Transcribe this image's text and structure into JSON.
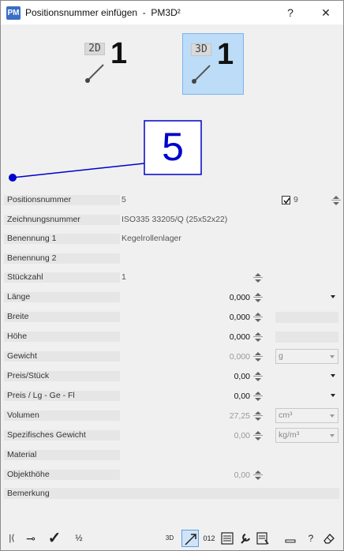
{
  "window": {
    "title": "Positionsnummer einfügen  -  PM3D²",
    "help_label": "?",
    "close_label": "✕",
    "app_icon_text": "PM"
  },
  "modes": {
    "mode_2d": {
      "tag": "2D",
      "number": "1",
      "active": false
    },
    "mode_3d": {
      "tag": "3D",
      "number": "1",
      "active": true
    }
  },
  "preview": {
    "balloon_number": "5",
    "line_color": "#0000cc"
  },
  "form": {
    "positionsnummer": {
      "label": "Positionsnummer",
      "value": "5",
      "checkbox_checked": true,
      "checkbox_label": "9"
    },
    "zeichnungsnummer": {
      "label": "Zeichnungsnummer",
      "value": "ISO335 33205/Q (25x52x22)"
    },
    "benennung1": {
      "label": "Benennung 1",
      "value": "Kegelrollenlager"
    },
    "benennung2": {
      "label": "Benennung 2",
      "value": ""
    },
    "stueckzahl": {
      "label": "Stückzahl",
      "value": "1"
    },
    "laenge": {
      "label": "Länge",
      "value": "0,000",
      "unit": ""
    },
    "breite": {
      "label": "Breite",
      "value": "0,000"
    },
    "hoehe": {
      "label": "Höhe",
      "value": "0,000"
    },
    "gewicht": {
      "label": "Gewicht",
      "value": "0,000",
      "unit": "g"
    },
    "preis_stueck": {
      "label": "Preis/Stück",
      "value": "0,00",
      "unit": ""
    },
    "preis_lg": {
      "label": "Preis / Lg - Ge - Fl",
      "value": "0,00",
      "unit": ""
    },
    "volumen": {
      "label": "Volumen",
      "value": "27,25",
      "unit": "cm³"
    },
    "spez_gewicht": {
      "label": "Spezifisches Gewicht",
      "value": "0,00",
      "unit": "kg/m³"
    },
    "material": {
      "label": "Material",
      "value": ""
    },
    "objekthoehe": {
      "label": "Objekthöhe",
      "value": "0,00"
    },
    "bemerkung": {
      "label": "Bemerkung",
      "value": ""
    }
  },
  "toolbar": {
    "first_label": "|⟨",
    "pin_label": "⊸",
    "ok_label": "✓",
    "fraction_label": "½",
    "mode3d_label": "3D",
    "sequence_label": "012",
    "help_label": "?"
  }
}
